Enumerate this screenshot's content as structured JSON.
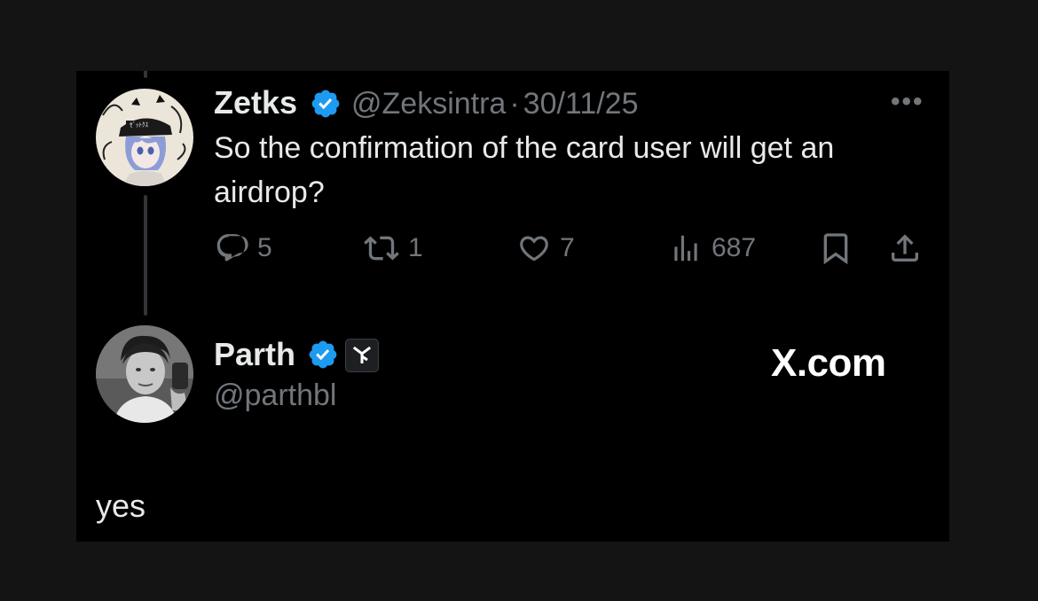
{
  "tweet": {
    "author": {
      "name": "Zetks",
      "handle": "@Zeksintra",
      "verified": true,
      "avatar_icon": "anime-avatar-icon"
    },
    "separator": "·",
    "date": "30/11/25",
    "more_label": "•••",
    "text_lines": [
      "So the confirmation of the card user will get an",
      "airdrop?"
    ],
    "actions": {
      "replies": "5",
      "reposts": "1",
      "likes": "7",
      "views": "687"
    }
  },
  "reply": {
    "author": {
      "name": "Parth",
      "handle": "@parthbl",
      "verified": true,
      "avatar_icon": "portrait-avatar-icon",
      "affiliation_icon": "affiliation-badge-icon"
    },
    "text": "yes"
  },
  "watermark": {
    "text": "X.com"
  },
  "colors": {
    "background": "#141414",
    "card": "#000000",
    "primary_text": "#e7e9ea",
    "secondary_text": "#71767b",
    "verified_blue": "#1d9bf0"
  }
}
